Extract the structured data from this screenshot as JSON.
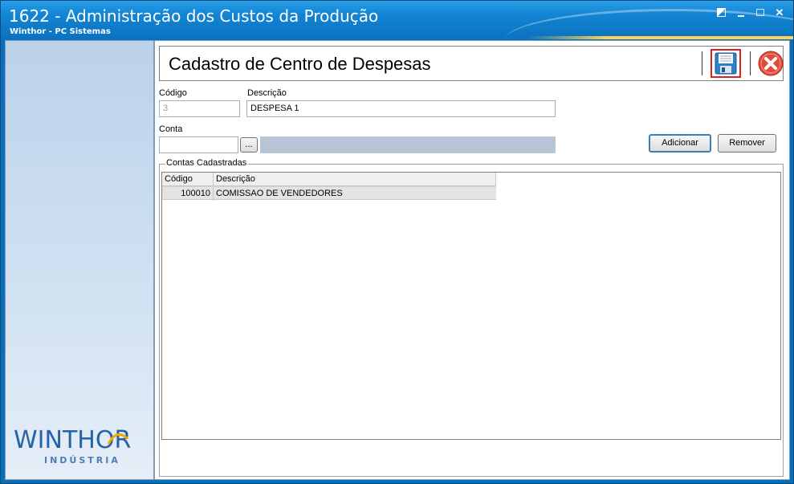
{
  "window": {
    "title": "1622 - Administração dos Custos da Produção",
    "subtitle": "Winthor - PC Sistemas"
  },
  "logo": {
    "main": "WINTHOR",
    "sub": "INDÚSTRIA"
  },
  "form": {
    "title": "Cadastro de Centro de Despesas",
    "codigo_label": "Código",
    "codigo_value": "3",
    "descricao_label": "Descrição",
    "descricao_value": "DESPESA 1",
    "conta_label": "Conta",
    "conta_value": "",
    "conta_lookup_label": "...",
    "conta_desc_value": "",
    "adicionar_label": "Adicionar",
    "remover_label": "Remover"
  },
  "contas": {
    "group_label": "Contas Cadastradas",
    "columns": [
      "Código",
      "Descrição"
    ],
    "rows": [
      {
        "codigo": "100010",
        "descricao": "COMISSAO DE VENDEDORES"
      }
    ]
  },
  "colors": {
    "titlebar": "#1385d4",
    "highlight_border": "#e02020",
    "close_red": "#e24a3b"
  }
}
